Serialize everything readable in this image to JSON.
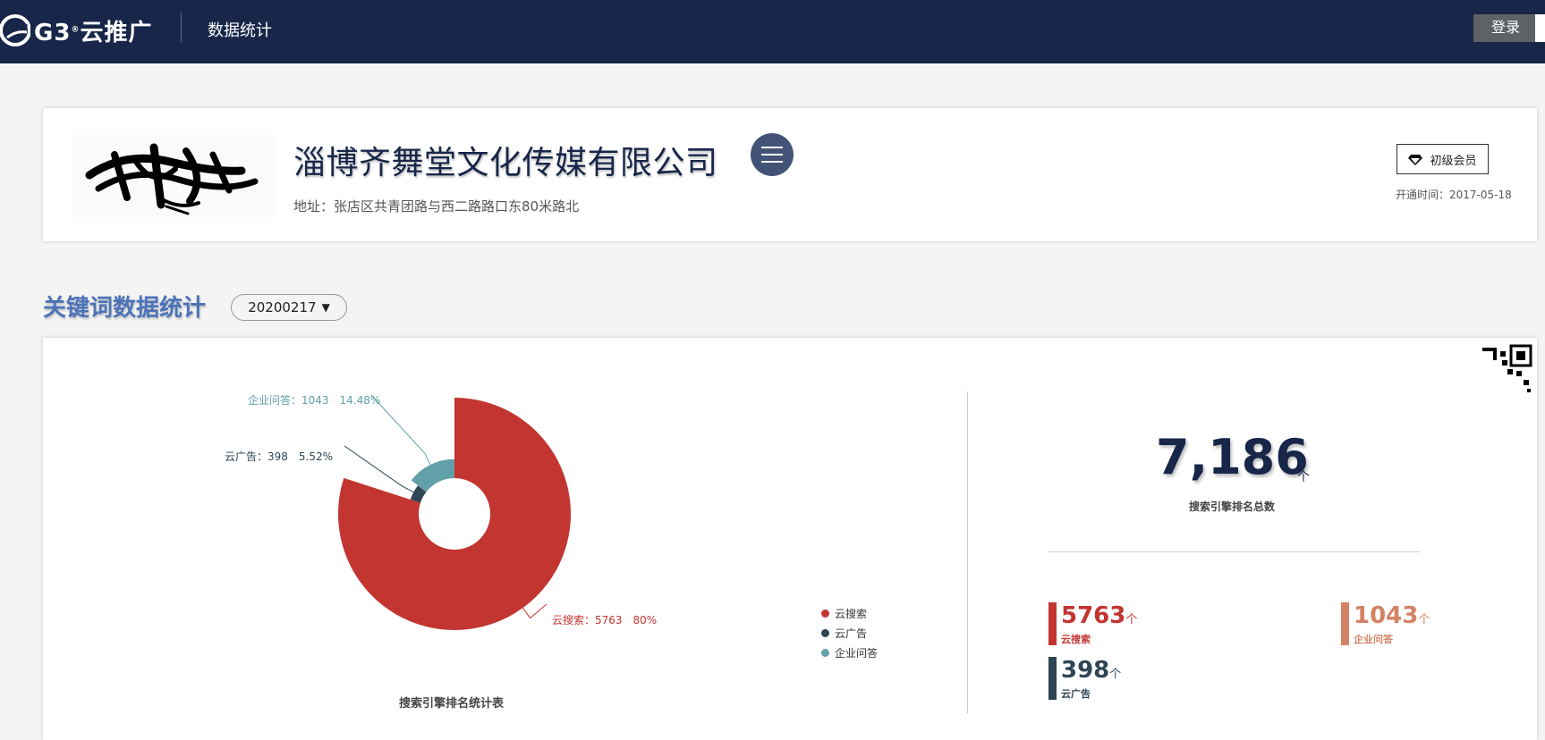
{
  "header": {
    "brand": "G3",
    "brand_mark": "®",
    "brand_suffix": "云推广",
    "section": "数据统计",
    "login_label": "登录"
  },
  "company": {
    "name": "淄博齐舞堂文化传媒有限公司",
    "address": "地址：张店区共青团路与西二路路口东80米路北",
    "member_level": "初级会员",
    "open_time": "开通时间：2017-05-18"
  },
  "keywords": {
    "title": "关键词数据统计",
    "date_value": "20200217"
  },
  "chart_data": {
    "type": "pie",
    "style": "donut",
    "title": "搜索引擎排名统计表",
    "categories": [
      "云搜索",
      "云广告",
      "企业问答"
    ],
    "values": [
      5763,
      398,
      1043
    ],
    "percents": [
      "80%",
      "5.52%",
      "14.48%"
    ],
    "labels": [
      "云搜索：5763　80%",
      "云广告：398　5.52%",
      "企业问答：1043　14.48%"
    ],
    "colors": [
      "#c23531",
      "#2f4554",
      "#61a0a8"
    ],
    "legend_position": "bottom-right"
  },
  "summary": {
    "total_value": "7,186",
    "total_unit": "个",
    "total_label": "搜索引擎排名总数",
    "items": [
      {
        "value": "5763",
        "unit": "个",
        "label": "云搜索",
        "color": "#c23531"
      },
      {
        "value": "1043",
        "unit": "个",
        "label": "企业问答",
        "color": "#d48265"
      },
      {
        "value": "398",
        "unit": "个",
        "label": "云广告",
        "color": "#2f4554"
      }
    ]
  }
}
